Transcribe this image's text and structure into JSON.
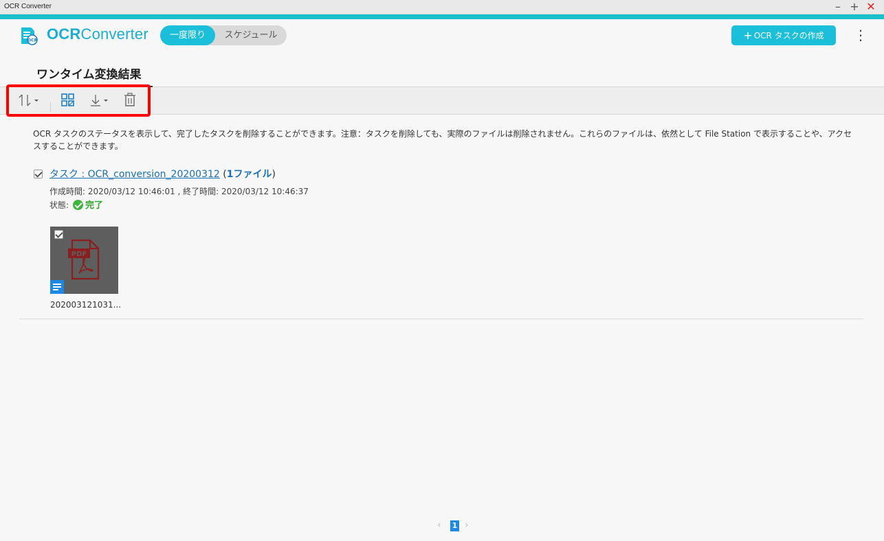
{
  "window": {
    "title": "OCR Converter",
    "minimize_icon": "minimize-icon",
    "maximize_icon": "maximize-icon",
    "close_icon": "close-icon"
  },
  "header": {
    "brand_bold": "OCR",
    "brand_light": "Converter",
    "modes": [
      {
        "label": "一度限り",
        "active": true
      },
      {
        "label": "スケジュール",
        "active": false
      }
    ],
    "create_label": "OCR タスクの作成",
    "accent_color": "#1bbfd9"
  },
  "tabs": [
    {
      "label": "ワンタイム変換結果",
      "active": true
    }
  ],
  "toolbar": {
    "items": [
      "sort-icon",
      "grid-view-icon",
      "download-icon",
      "delete-icon"
    ],
    "highlight_color": "#ff0000"
  },
  "description": "OCR タスクのステータスを表示して、完了したタスクを削除することができます。注意：タスクを削除しても、実際のファイルは削除されません。これらのファイルは、依然として File Station で表示することや、アクセスすることができます。",
  "task": {
    "checked": true,
    "title": "タスク : OCR_conversion_20200312",
    "count_open": " (",
    "count": "1ファイル",
    "count_close": ")",
    "meta": "作成時間: 2020/03/12 10:46:01 , 終了時間: 2020/03/12 10:46:37",
    "status_label": "状態:",
    "status_value": "完了",
    "status_color": "#2ea52e",
    "files": [
      {
        "name": "202003121031...",
        "badge": "PDF",
        "checked": true
      }
    ]
  },
  "pagination": {
    "current": "1",
    "prev_icon": "chevron-left-icon",
    "next_icon": "chevron-right-icon"
  }
}
